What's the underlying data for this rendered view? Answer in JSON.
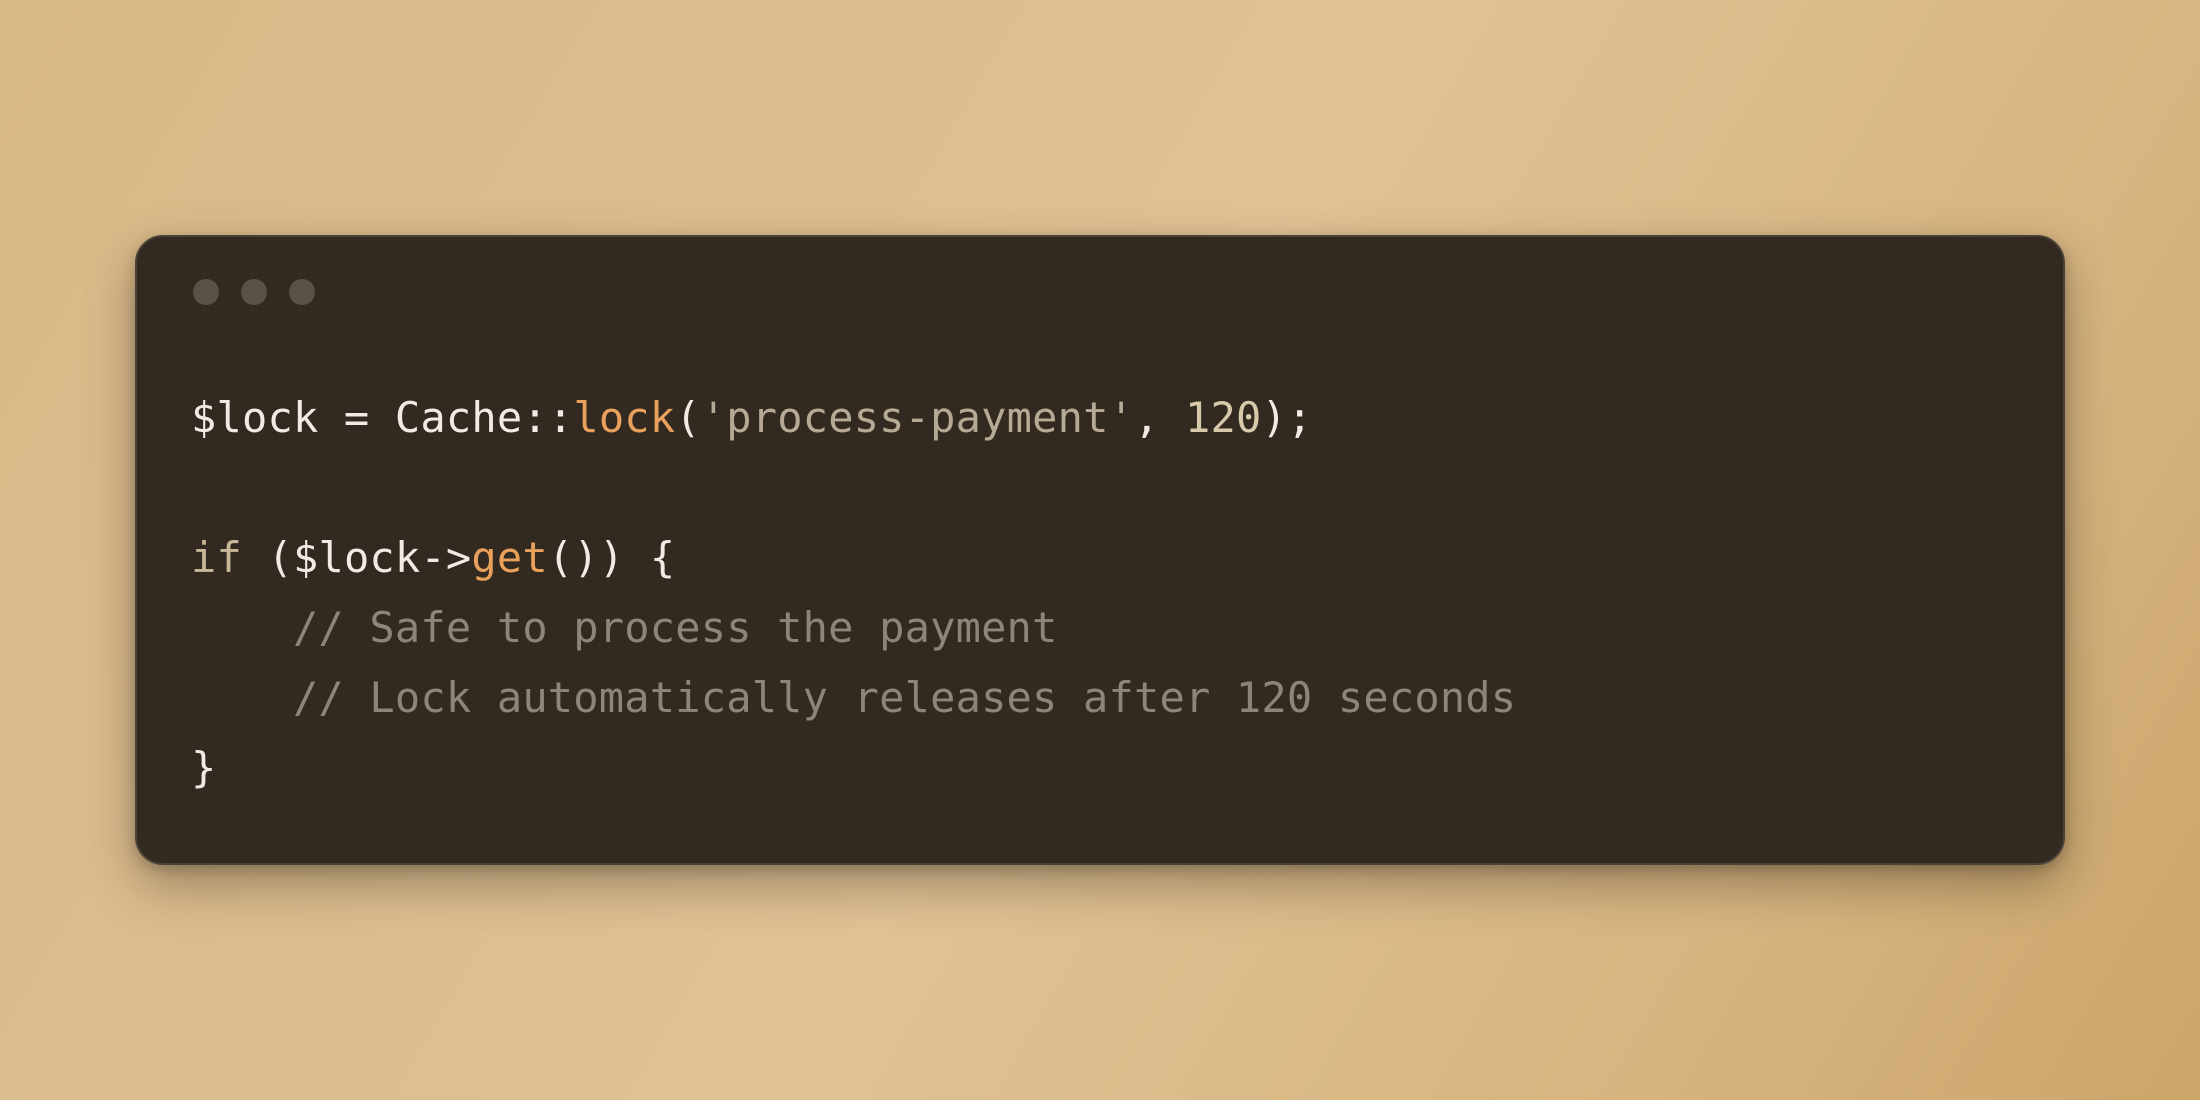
{
  "titlebar": {
    "dot_color": "#5a5148"
  },
  "code": {
    "tokens": [
      [
        {
          "t": "$lock",
          "c": "c-var"
        },
        {
          "t": " = ",
          "c": "c-default"
        },
        {
          "t": "Cache",
          "c": "c-class"
        },
        {
          "t": "::",
          "c": "c-punct"
        },
        {
          "t": "lock",
          "c": "c-func"
        },
        {
          "t": "(",
          "c": "c-punct"
        },
        {
          "t": "'process-payment'",
          "c": "c-string"
        },
        {
          "t": ", ",
          "c": "c-punct"
        },
        {
          "t": "120",
          "c": "c-number"
        },
        {
          "t": ");",
          "c": "c-punct"
        }
      ],
      [],
      [
        {
          "t": "if",
          "c": "c-keyword"
        },
        {
          "t": " (",
          "c": "c-punct"
        },
        {
          "t": "$lock",
          "c": "c-var"
        },
        {
          "t": "->",
          "c": "c-punct"
        },
        {
          "t": "get",
          "c": "c-func"
        },
        {
          "t": "()",
          "c": "c-punct"
        },
        {
          "t": ") {",
          "c": "c-punct"
        }
      ],
      [
        {
          "t": "    // Safe to process the payment",
          "c": "c-comment"
        }
      ],
      [
        {
          "t": "    // Lock automatically releases after 120 seconds",
          "c": "c-comment"
        }
      ],
      [
        {
          "t": "}",
          "c": "c-punct"
        }
      ]
    ]
  }
}
